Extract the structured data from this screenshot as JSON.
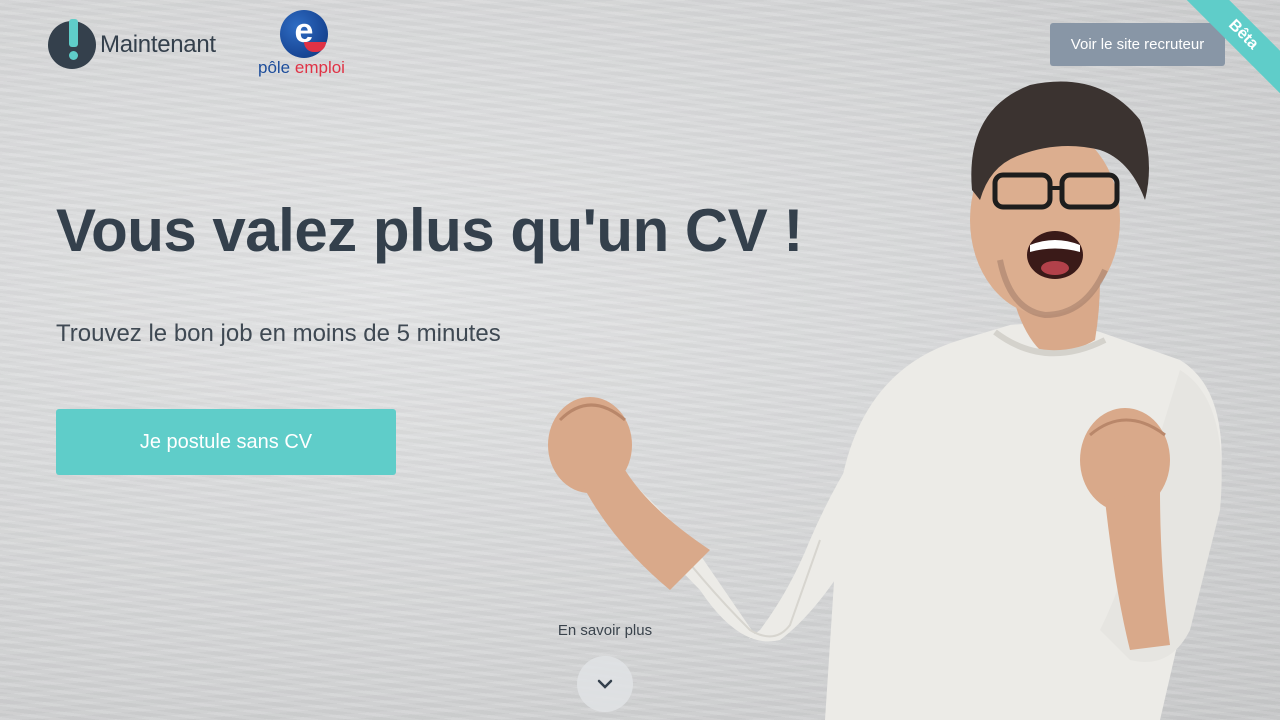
{
  "header": {
    "brand_name": "Maintenant",
    "partner_logo": {
      "word1": "pôle",
      "word2": "emploi",
      "mark": "e"
    },
    "recruiter_button_label": "Voir le site recruteur",
    "beta_label": "Bêta"
  },
  "hero": {
    "headline": "Vous valez plus qu'un CV !",
    "subheadline": "Trouvez le bon job en moins de 5 minutes",
    "cta_label": "Je postule sans CV"
  },
  "scroll_hint": {
    "label": "En savoir plus",
    "icon": "chevron-down-icon"
  },
  "colors": {
    "accent": "#5fcdc9",
    "text_dark": "#34404c",
    "recruiter_button": "#8896a6",
    "pole_emploi_blue": "#1d4d9b",
    "pole_emploi_red": "#e03245"
  }
}
